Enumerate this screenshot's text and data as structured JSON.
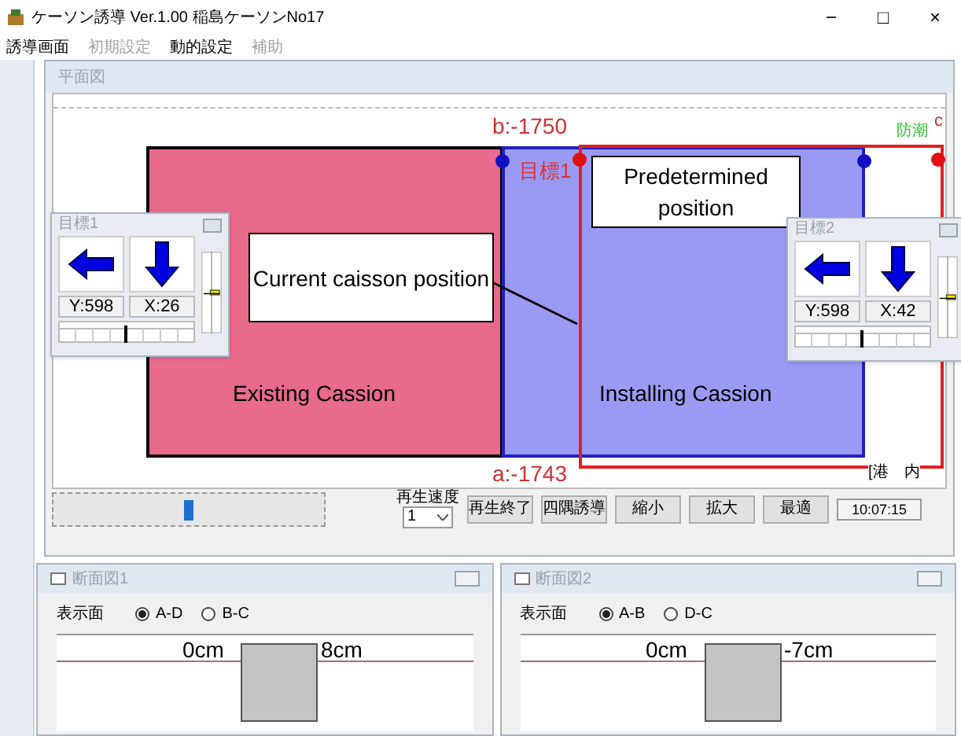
{
  "window": {
    "title": "ケーソン誘導 Ver.1.00 稲島ケーソンNo17",
    "controls": [
      "−",
      "□",
      "×"
    ]
  },
  "menu": [
    {
      "label": "誘導画面",
      "disabled": false
    },
    {
      "label": "初期設定",
      "disabled": true
    },
    {
      "label": "動的設定",
      "disabled": false
    },
    {
      "label": "補助",
      "disabled": true
    }
  ],
  "plan_view": {
    "title": "平面図",
    "labels": {
      "top": "b:-1750",
      "bottom": "a:-1743",
      "target": "目標1",
      "corner": "c",
      "wall": "防潮",
      "harbor": "[港　内"
    },
    "callouts": [
      {
        "kind": "box",
        "text": "Current caisson position"
      },
      {
        "kind": "box",
        "text": "Predetermined position"
      },
      {
        "kind": "plain",
        "text": "Existing Cassion"
      },
      {
        "kind": "plain",
        "text": "Installing Cassion"
      }
    ],
    "targets": [
      {
        "title": "目標1",
        "y": "Y:598",
        "x": "X:26"
      },
      {
        "title": "目標2",
        "y": "Y:598",
        "x": "X:42"
      }
    ],
    "playback": {
      "speed_label": "再生速度",
      "speed": "1",
      "level": 0.5
    },
    "buttons": [
      "再生終了",
      "四隅誘導",
      "縮小",
      "拡大",
      "最適"
    ],
    "time": "10:07:15"
  },
  "sections": [
    {
      "title": "断面図1",
      "face_label": "表示面",
      "options": [
        {
          "label": "A-D",
          "selected": true
        },
        {
          "label": "B-C",
          "selected": false
        }
      ],
      "left": "0cm",
      "right": "8cm"
    },
    {
      "title": "断面図2",
      "face_label": "表示面",
      "options": [
        {
          "label": "A-B",
          "selected": true
        },
        {
          "label": "D-C",
          "selected": false
        }
      ],
      "left": "0cm",
      "right": "-7cm"
    }
  ]
}
